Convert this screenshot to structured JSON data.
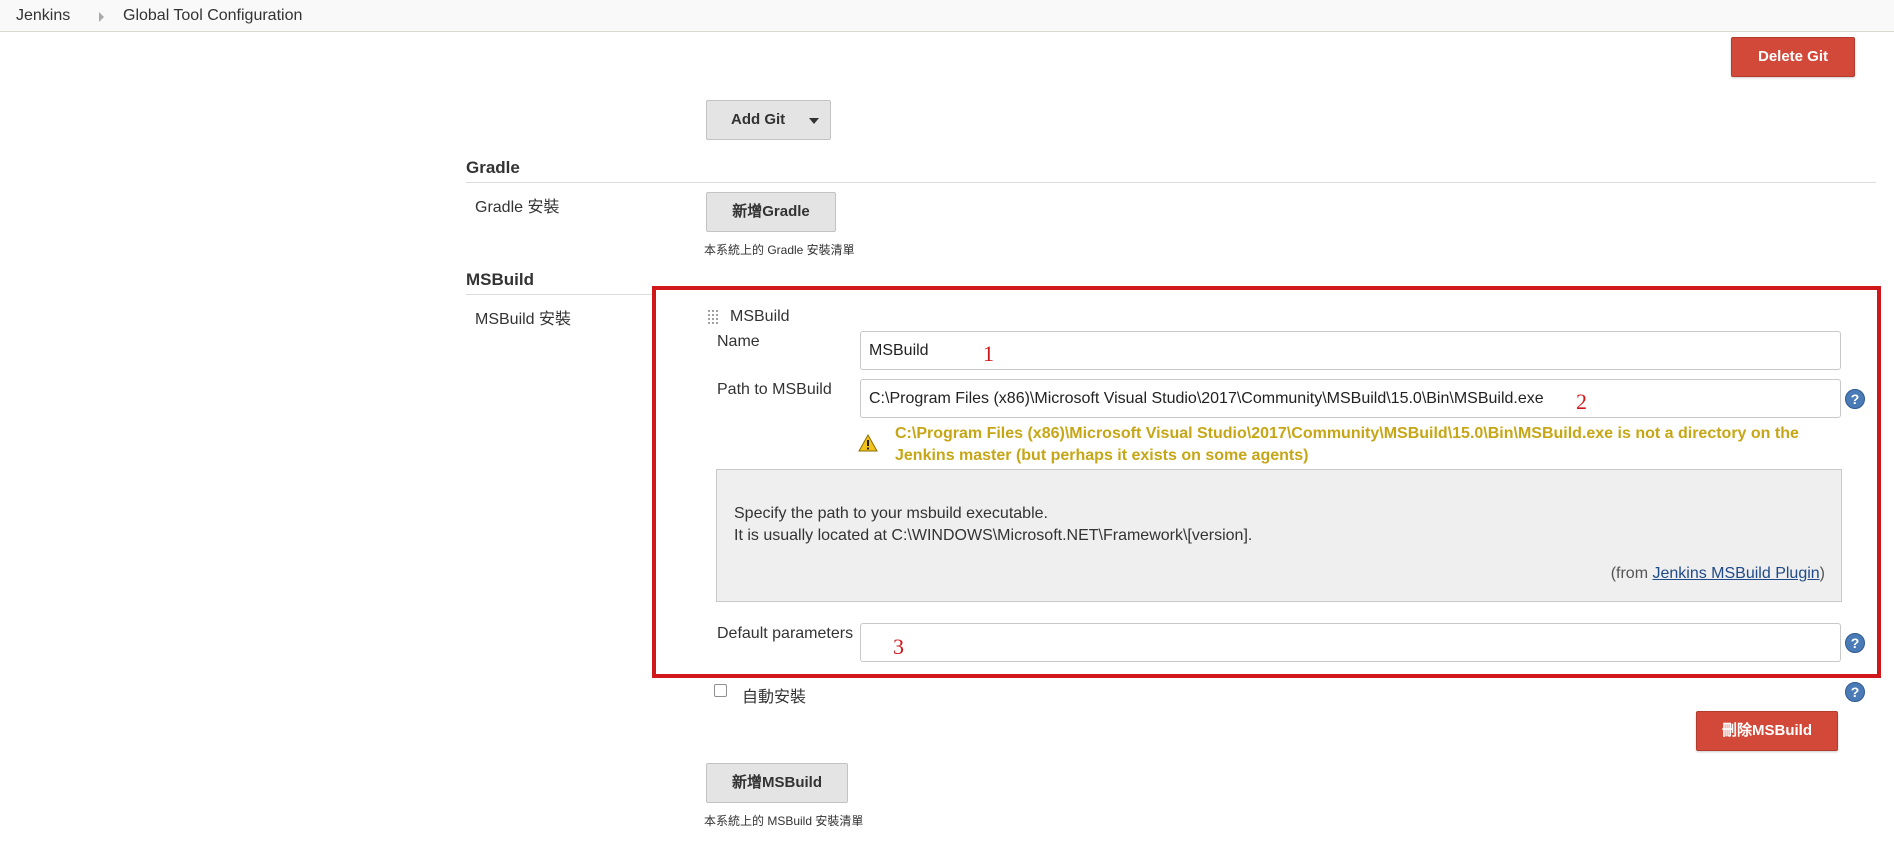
{
  "breadcrumb": {
    "home": "Jenkins",
    "current": "Global Tool Configuration"
  },
  "git": {
    "delete_button": "Delete Git",
    "add_button": "Add Git"
  },
  "gradle": {
    "section_title": "Gradle",
    "installs_label": "Gradle 安裝",
    "add_button": "新增Gradle",
    "description": "本系統上的 Gradle 安裝清單"
  },
  "msbuild": {
    "section_title": "MSBuild",
    "installs_label": "MSBuild 安裝",
    "entry_title": "MSBuild",
    "name_label": "Name",
    "name_value": "MSBuild",
    "path_label": "Path to MSBuild",
    "path_value": "C:\\Program Files (x86)\\Microsoft Visual Studio\\2017\\Community\\MSBuild\\15.0\\Bin\\MSBuild.exe",
    "path_warning": "C:\\Program Files (x86)\\Microsoft Visual Studio\\2017\\Community\\MSBuild\\15.0\\Bin\\MSBuild.exe is not a directory on the Jenkins master (but perhaps it exists on some agents)",
    "help_line1": "Specify the path to your msbuild executable.",
    "help_line2": "It is usually located at C:\\WINDOWS\\Microsoft.NET\\Framework\\[version].",
    "help_from_prefix": "(from ",
    "help_from_link": "Jenkins MSBuild Plugin",
    "help_from_suffix": ")",
    "default_params_label": "Default parameters",
    "default_params_value": "",
    "auto_install_label": "自動安裝",
    "delete_button": "刪除MSBuild",
    "add_button": "新增MSBuild",
    "description": "本系統上的 MSBuild 安裝清單"
  },
  "annotations": {
    "one": "1",
    "two": "2",
    "three": "3"
  },
  "colors": {
    "danger_button": "#d24939",
    "warning_text": "#c7a616",
    "annotation_red": "#d0181b",
    "help_icon": "#4a7bb7"
  },
  "icons": {
    "help": "help-icon",
    "warning": "warning-icon",
    "drag": "drag-handle-icon",
    "breadcrumb_separator": "chevron-right-icon",
    "dropdown": "caret-down-icon"
  }
}
